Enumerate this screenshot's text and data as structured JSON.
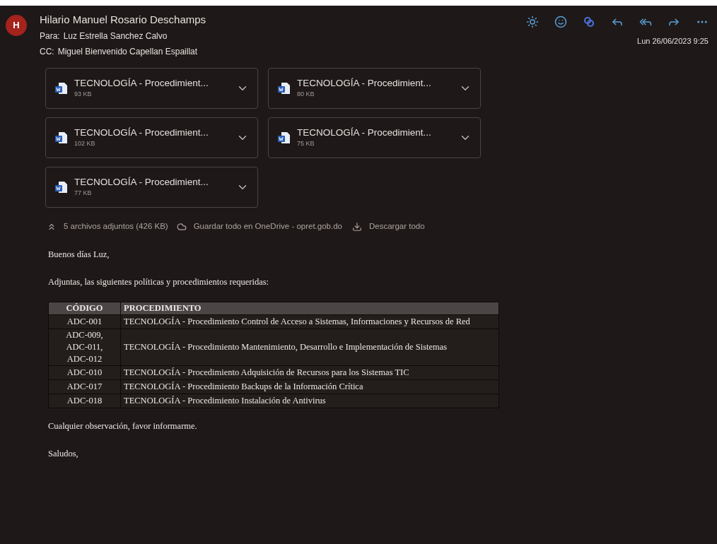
{
  "sender": {
    "initial": "H",
    "name": "Hilario Manuel Rosario Deschamps"
  },
  "to": {
    "label": "Para:",
    "value": "Luz Estrella Sanchez Calvo"
  },
  "cc": {
    "label": "CC:",
    "value": "Miguel Bienvenido Capellan Espaillat"
  },
  "date": "Lun 26/06/2023 9:25",
  "attachments": [
    {
      "name": "TECNOLOGÍA - Procedimient...",
      "size": "93 KB"
    },
    {
      "name": "TECNOLOGÍA - Procedimient...",
      "size": "80 KB"
    },
    {
      "name": "TECNOLOGÍA - Procedimient...",
      "size": "102 KB"
    },
    {
      "name": "TECNOLOGÍA - Procedimient...",
      "size": "75 KB"
    },
    {
      "name": "TECNOLOGÍA - Procedimient...",
      "size": "77 KB"
    }
  ],
  "attachment_bar": {
    "summary": "5 archivos adjuntos (426 KB)",
    "save_all": "Guardar todo en OneDrive - opret.gob.do",
    "download_all": "Descargar todo"
  },
  "greeting": "Buenos días Luz,",
  "intro": "Adjuntas, las siguientes políticas y procedimientos requeridas:",
  "table": {
    "columns": [
      "CÓDIGO",
      "PROCEDIMIENTO"
    ],
    "rows": [
      {
        "code": [
          "ADC-001"
        ],
        "procedure": "TECNOLOGÍA - Procedimiento Control de Acceso a Sistemas, Informaciones y Recursos de Red"
      },
      {
        "code": [
          "ADC-009,",
          "ADC-011,",
          "ADC-012"
        ],
        "procedure": "TECNOLOGÍA - Procedimiento Mantenimiento, Desarrollo e Implementación de Sistemas"
      },
      {
        "code": [
          "ADC-010"
        ],
        "procedure": "TECNOLOGÍA - Procedimiento Adquisición de Recursos para los Sistemas TIC"
      },
      {
        "code": [
          "ADC-017"
        ],
        "procedure": "TECNOLOGÍA - Procedimiento Backups de la Información Crítica"
      },
      {
        "code": [
          "ADC-018"
        ],
        "procedure": "TECNOLOGÍA - Procedimiento Instalación de Antivirus"
      }
    ]
  },
  "closing": "Cualquier observación, favor informarme.",
  "signoff": "Saludos,"
}
